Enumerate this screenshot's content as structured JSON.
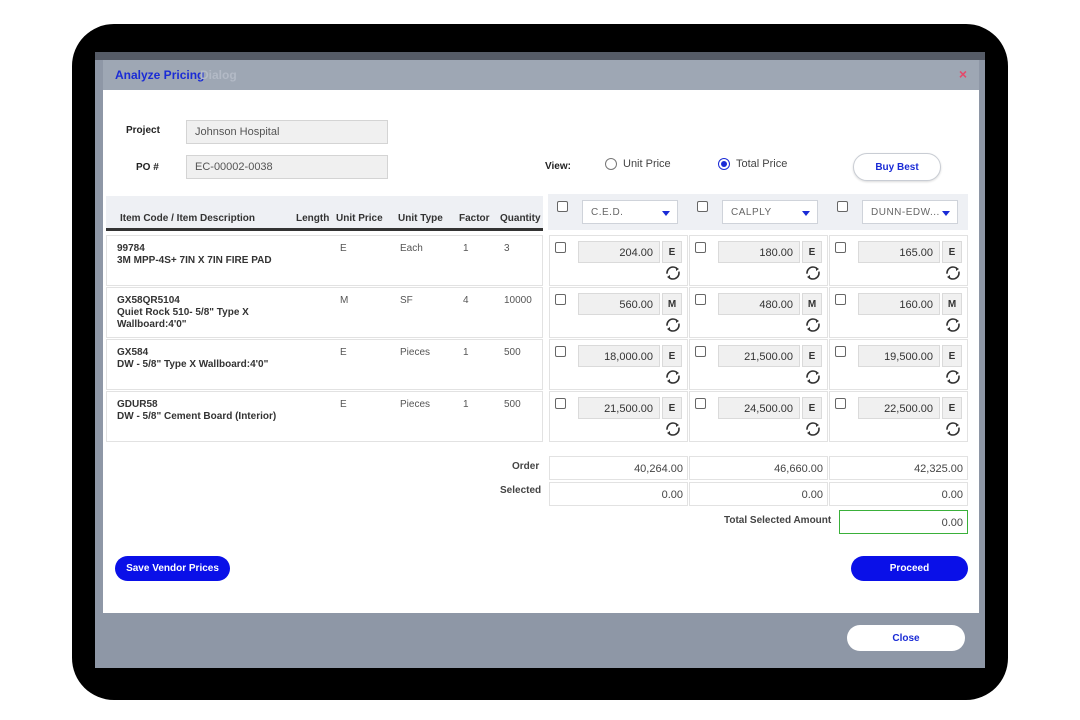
{
  "modal": {
    "title": "Analyze Pricing",
    "title_ghost": "Dialog",
    "close_glyph": "×"
  },
  "form": {
    "project_label": "Project",
    "project_value": "Johnson Hospital",
    "po_label": "PO #",
    "po_value": "EC-00002-0038"
  },
  "view": {
    "label": "View:",
    "options": [
      {
        "label": "Unit Price",
        "selected": false
      },
      {
        "label": "Total Price",
        "selected": true
      }
    ]
  },
  "buy_best_label": "Buy Best",
  "table": {
    "headers": [
      "Item Code / Item Description",
      "Length",
      "Unit Price",
      "Unit Type",
      "Factor",
      "Quantity"
    ],
    "vendors": [
      "C.E.D.",
      "CALPLY",
      "DUNN-EDW..."
    ],
    "rows": [
      {
        "code": "99784",
        "desc": "3M MPP-4S+ 7IN X 7IN FIRE PAD",
        "length": "",
        "unit_price": "E",
        "unit_type": "Each",
        "factor": "1",
        "quantity": "3",
        "prices": [
          {
            "value": "204.00",
            "unit": "E"
          },
          {
            "value": "180.00",
            "unit": "E"
          },
          {
            "value": "165.00",
            "unit": "E"
          }
        ]
      },
      {
        "code": "GX58QR5104",
        "desc": "Quiet Rock 510- 5/8\" Type X Wallboard:4'0\"",
        "length": "",
        "unit_price": "M",
        "unit_type": "SF",
        "factor": "4",
        "quantity": "10000",
        "prices": [
          {
            "value": "560.00",
            "unit": "M"
          },
          {
            "value": "480.00",
            "unit": "M"
          },
          {
            "value": "160.00",
            "unit": "M"
          }
        ]
      },
      {
        "code": "GX584",
        "desc": "DW - 5/8\" Type X Wallboard:4'0\"",
        "length": "",
        "unit_price": "E",
        "unit_type": "Pieces",
        "factor": "1",
        "quantity": "500",
        "prices": [
          {
            "value": "18,000.00",
            "unit": "E"
          },
          {
            "value": "21,500.00",
            "unit": "E"
          },
          {
            "value": "19,500.00",
            "unit": "E"
          }
        ]
      },
      {
        "code": "GDUR58",
        "desc": "DW - 5/8\" Cement Board (Interior)",
        "length": "",
        "unit_price": "E",
        "unit_type": "Pieces",
        "factor": "1",
        "quantity": "500",
        "prices": [
          {
            "value": "21,500.00",
            "unit": "E"
          },
          {
            "value": "24,500.00",
            "unit": "E"
          },
          {
            "value": "22,500.00",
            "unit": "E"
          }
        ]
      }
    ]
  },
  "summary": {
    "order_label": "Order",
    "order_values": [
      "40,264.00",
      "46,660.00",
      "42,325.00"
    ],
    "selected_label": "Selected",
    "selected_values": [
      "0.00",
      "0.00",
      "0.00"
    ],
    "total_label": "Total Selected Amount",
    "total_value": "0.00"
  },
  "buttons": {
    "save_vendor_prices": "Save Vendor Prices",
    "proceed": "Proceed",
    "close": "Close"
  },
  "colors": {
    "accent": "#0a10e8",
    "header_bar": "#9ea7b4",
    "close_x": "#e5486a",
    "total_border": "#3ab03a"
  }
}
